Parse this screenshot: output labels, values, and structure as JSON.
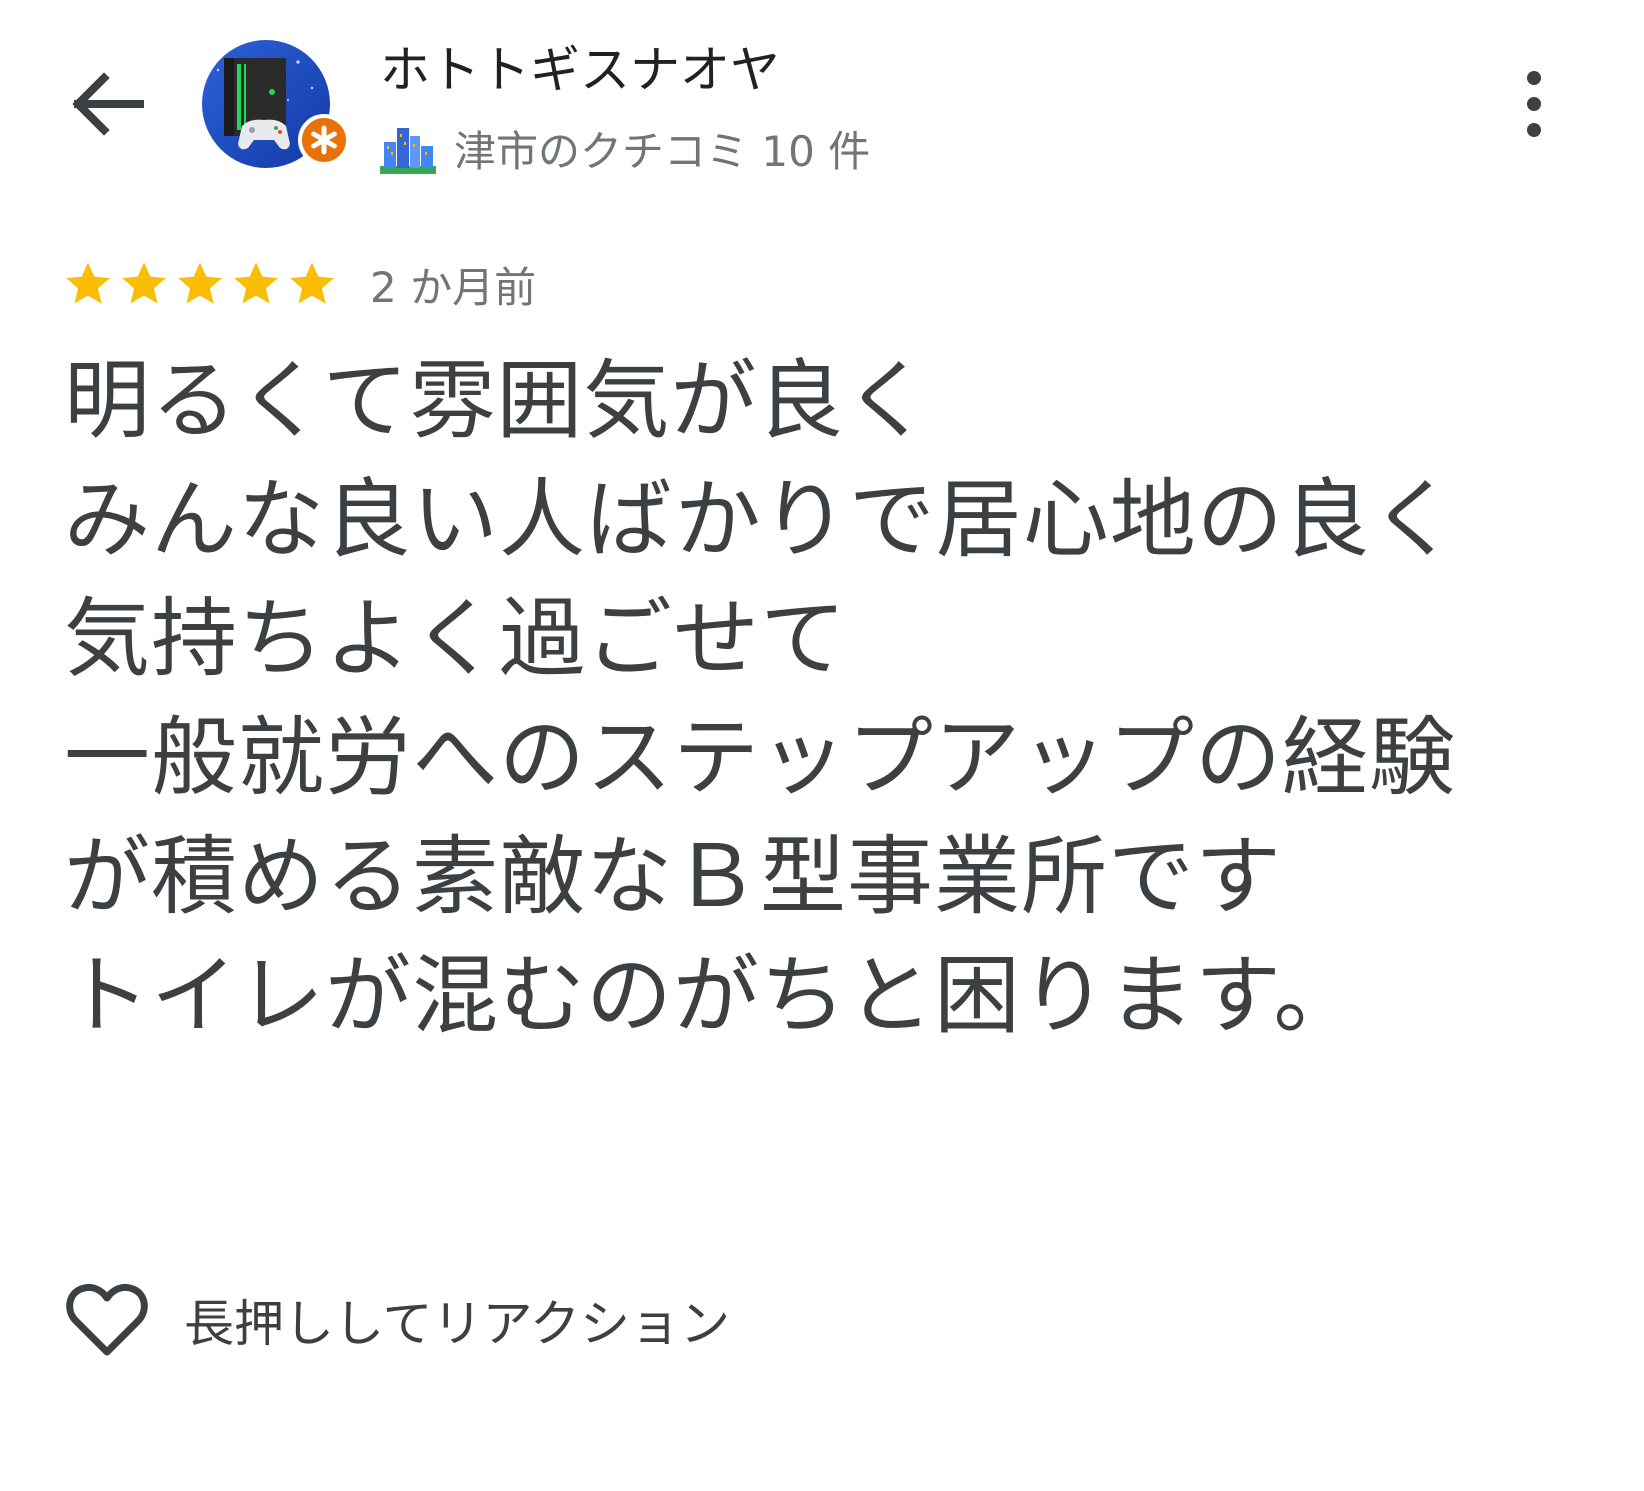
{
  "header": {
    "user_name": "ホトトギスナオヤ",
    "review_count_text": "津市のクチコミ 10 件",
    "back_icon": "arrow-back-icon",
    "more_icon": "more-vert-icon",
    "avatar_icon": "game-console-avatar",
    "badge_icon": "local-guide-badge-icon",
    "city_icon": "city-buildings-icon"
  },
  "review": {
    "rating": 5,
    "rating_max": 5,
    "time_ago": "2 か月前",
    "text": "明るくて雰囲気が良く\nみんな良い人ばかりで居心地の良く\n気持ちよく過ごせて\n一般就労へのステップアップの経験が積める素敵なＢ型事業所です\nトイレが混むのがちと困ります。"
  },
  "reaction": {
    "label": "長押ししてリアクション",
    "icon": "heart-outline-icon"
  },
  "colors": {
    "star": "#fbbc04",
    "badge": "#e8710a",
    "text_primary": "#202124",
    "text_body": "#3c4043",
    "text_secondary": "#70757a",
    "avatar_bg": "#1a4fc4"
  }
}
